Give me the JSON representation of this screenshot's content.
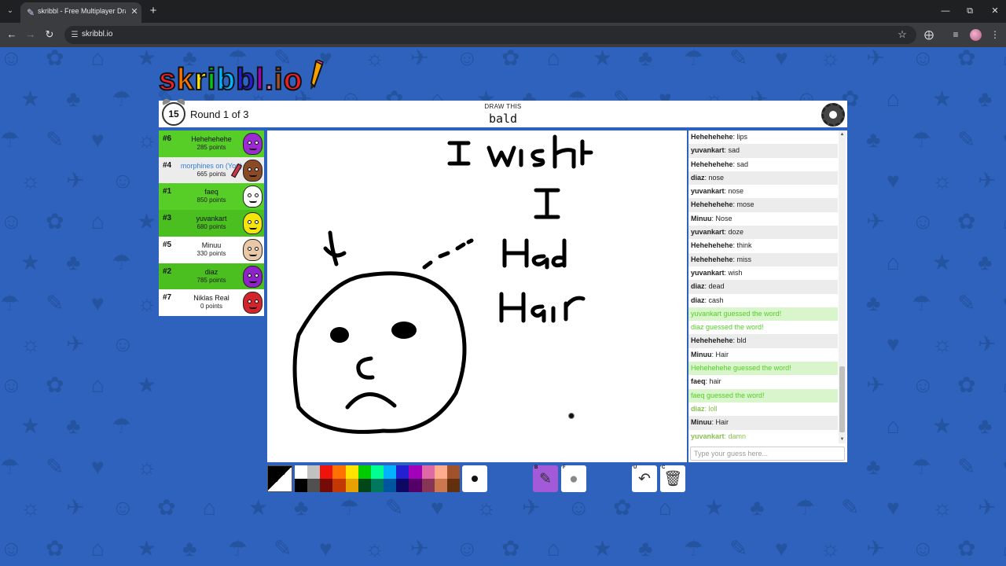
{
  "browser": {
    "tab_title": "skribbl - Free Multiplayer Drawing & Guessing Game",
    "url": "skribbl.io",
    "favicon": "pencil-icon"
  },
  "logo": {
    "letters": [
      "s",
      "k",
      "r",
      "i",
      "b",
      "b",
      "l",
      ".",
      "i",
      "o"
    ],
    "colors": [
      "#ef1f29",
      "#ff7400",
      "#ffe500",
      "#00cc18",
      "#00b2ff",
      "#231fd3",
      "#a300ba",
      "#d37caa",
      "#a0522d",
      "#ef1f29"
    ]
  },
  "header": {
    "timer": "15",
    "round": "Round 1 of 3",
    "draw_this_label": "DRAW THIS",
    "word": "bald"
  },
  "players": [
    {
      "rank": "#6",
      "name": "Hehehehehe",
      "points": "285 points",
      "guessed": true,
      "avatar_color": "#9b2ad3"
    },
    {
      "rank": "#4",
      "name": "morphines on (You)",
      "points": "665 points",
      "guessed": false,
      "me": true,
      "drawing": true,
      "avatar_color": "#8a4a26"
    },
    {
      "rank": "#1",
      "name": "faeq",
      "points": "850 points",
      "guessed": true,
      "avatar_color": "#ffffff"
    },
    {
      "rank": "#3",
      "name": "yuvankart",
      "points": "680 points",
      "guessed": true,
      "avatar_color": "#f5e50c"
    },
    {
      "rank": "#5",
      "name": "Minuu",
      "points": "330 points",
      "guessed": false,
      "avatar_color": "#e9c8a8"
    },
    {
      "rank": "#2",
      "name": "diaz",
      "points": "785 points",
      "guessed": true,
      "avatar_color": "#8e22c9"
    },
    {
      "rank": "#7",
      "name": "Niklas Real",
      "points": "0 points",
      "guessed": false,
      "avatar_color": "#d3242b"
    }
  ],
  "chat": {
    "messages": [
      {
        "who": "Hehehehehe",
        "text": "lips",
        "type": "normal"
      },
      {
        "who": "yuvankart",
        "text": "sad",
        "type": "normal"
      },
      {
        "who": "Hehehehehe",
        "text": "sad",
        "type": "normal"
      },
      {
        "who": "diaz",
        "text": "nose",
        "type": "normal"
      },
      {
        "who": "yuvankart",
        "text": "nose",
        "type": "normal"
      },
      {
        "who": "Hehehehehe",
        "text": "mose",
        "type": "normal"
      },
      {
        "who": "Minuu",
        "text": "Nose",
        "type": "normal"
      },
      {
        "who": "yuvankart",
        "text": "doze",
        "type": "normal"
      },
      {
        "who": "Hehehehehe",
        "text": "think",
        "type": "normal"
      },
      {
        "who": "Hehehehehe",
        "text": "miss",
        "type": "normal"
      },
      {
        "who": "yuvankart",
        "text": "wish",
        "type": "normal"
      },
      {
        "who": "diaz",
        "text": "dead",
        "type": "normal"
      },
      {
        "who": "diaz",
        "text": "cash",
        "type": "normal"
      },
      {
        "who": "",
        "text": "yuvankart guessed the word!",
        "type": "guess"
      },
      {
        "who": "",
        "text": "diaz guessed the word!",
        "type": "guess"
      },
      {
        "who": "Hehehehehe",
        "text": "bld",
        "type": "normal"
      },
      {
        "who": "Minuu",
        "text": "Hair",
        "type": "normal"
      },
      {
        "who": "",
        "text": "Hehehehehe guessed the word!",
        "type": "guess"
      },
      {
        "who": "faeq",
        "text": "hair",
        "type": "normal"
      },
      {
        "who": "",
        "text": "faeq guessed the word!",
        "type": "guess"
      },
      {
        "who": "diaz",
        "text": "loll",
        "type": "close"
      },
      {
        "who": "Minuu",
        "text": "Hair",
        "type": "normal"
      },
      {
        "who": "yuvankart",
        "text": "damn",
        "type": "close"
      }
    ],
    "input_placeholder": "Type your guess here..."
  },
  "palette": {
    "top": [
      "#ffffff",
      "#c1c1c1",
      "#ef130b",
      "#ff7100",
      "#ffe400",
      "#00cc00",
      "#00ff91",
      "#00b2ff",
      "#231fd3",
      "#a300ba",
      "#df69a7",
      "#ffac8e",
      "#a0522d"
    ],
    "bottom": [
      "#000000",
      "#505050",
      "#740b07",
      "#c23800",
      "#e8a200",
      "#004619",
      "#00785d",
      "#00569e",
      "#0e0865",
      "#550069",
      "#873554",
      "#cc774d",
      "#63300d"
    ],
    "current": "#000000"
  },
  "tools": {
    "brush_key": "B",
    "fill_key": "F",
    "undo_key": "U",
    "clear_key": "C",
    "active": "brush"
  }
}
